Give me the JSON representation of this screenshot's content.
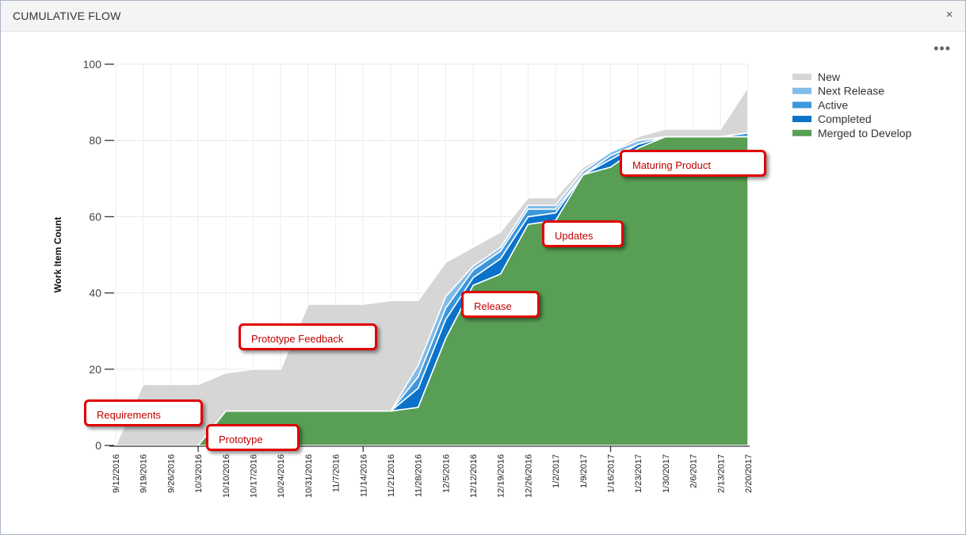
{
  "window": {
    "title": "CUMULATIVE FLOW",
    "close_label": "×",
    "more_label": "•••"
  },
  "colors": {
    "New": "#d6d6d6",
    "Next Release": "#82bce8",
    "Active": "#3c97db",
    "Completed": "#0a72c9",
    "Merged to Develop": "#589f55",
    "annotation_border": "#e00000",
    "annotation_text": "#c00000"
  },
  "chart_data": {
    "type": "area",
    "stacked": true,
    "ylabel": "Work Item Count",
    "xlabel": "",
    "ylim": [
      0,
      100
    ],
    "yticks": [
      0,
      20,
      40,
      60,
      80,
      100
    ],
    "grid": true,
    "legend_position": "top-right",
    "x": [
      "9/12/2016",
      "9/19/2016",
      "9/26/2016",
      "10/3/2016",
      "10/10/2016",
      "10/17/2016",
      "10/24/2016",
      "10/31/2016",
      "11/7/2016",
      "11/14/2016",
      "11/21/2016",
      "11/28/2016",
      "12/5/2016",
      "12/12/2016",
      "12/19/2016",
      "12/26/2016",
      "1/2/2017",
      "1/9/2017",
      "1/16/2017",
      "1/23/2017",
      "1/30/2017",
      "2/6/2017",
      "2/13/2017",
      "2/20/2017"
    ],
    "series": [
      {
        "name": "Merged to Develop",
        "values": [
          0,
          0,
          0,
          0,
          9,
          9,
          9,
          9,
          9,
          9,
          9,
          10,
          28,
          42,
          45,
          58,
          59,
          71,
          73,
          78,
          81,
          81,
          81,
          81
        ]
      },
      {
        "name": "Completed",
        "values": [
          0,
          0,
          0,
          0,
          0,
          0,
          0,
          0,
          0,
          0,
          0,
          5,
          5,
          2,
          4,
          2,
          2,
          0,
          2,
          1,
          0,
          0,
          0,
          0
        ]
      },
      {
        "name": "Active",
        "values": [
          0,
          0,
          0,
          0,
          0,
          0,
          0,
          0,
          0,
          0,
          0,
          3,
          3,
          2,
          2,
          2,
          1,
          0,
          1,
          0,
          0,
          0,
          0,
          1
        ]
      },
      {
        "name": "Next Release",
        "values": [
          0,
          0,
          0,
          0,
          0,
          0,
          0,
          0,
          0,
          0,
          0,
          3,
          3,
          1,
          1,
          1,
          1,
          1,
          1,
          1,
          0,
          0,
          0,
          0
        ]
      },
      {
        "name": "New",
        "values": [
          0,
          16,
          16,
          16,
          10,
          11,
          11,
          28,
          28,
          28,
          29,
          17,
          9,
          5,
          4,
          2,
          2,
          1,
          0,
          1,
          2,
          2,
          2,
          12
        ]
      }
    ],
    "annotations": [
      {
        "text": "Requirements",
        "x": "9/19/2016",
        "y": 8.5
      },
      {
        "text": "Prototype",
        "x": "10/17/2016",
        "y": 2
      },
      {
        "text": "Prototype Feedback",
        "x": "10/31/2016",
        "y": 28.5
      },
      {
        "text": "Release",
        "x": "12/19/2016",
        "y": 37
      },
      {
        "text": "Updates",
        "x": "1/9/2017",
        "y": 55.5
      },
      {
        "text": "Maturing Product",
        "x": "2/6/2017",
        "y": 74
      }
    ]
  }
}
